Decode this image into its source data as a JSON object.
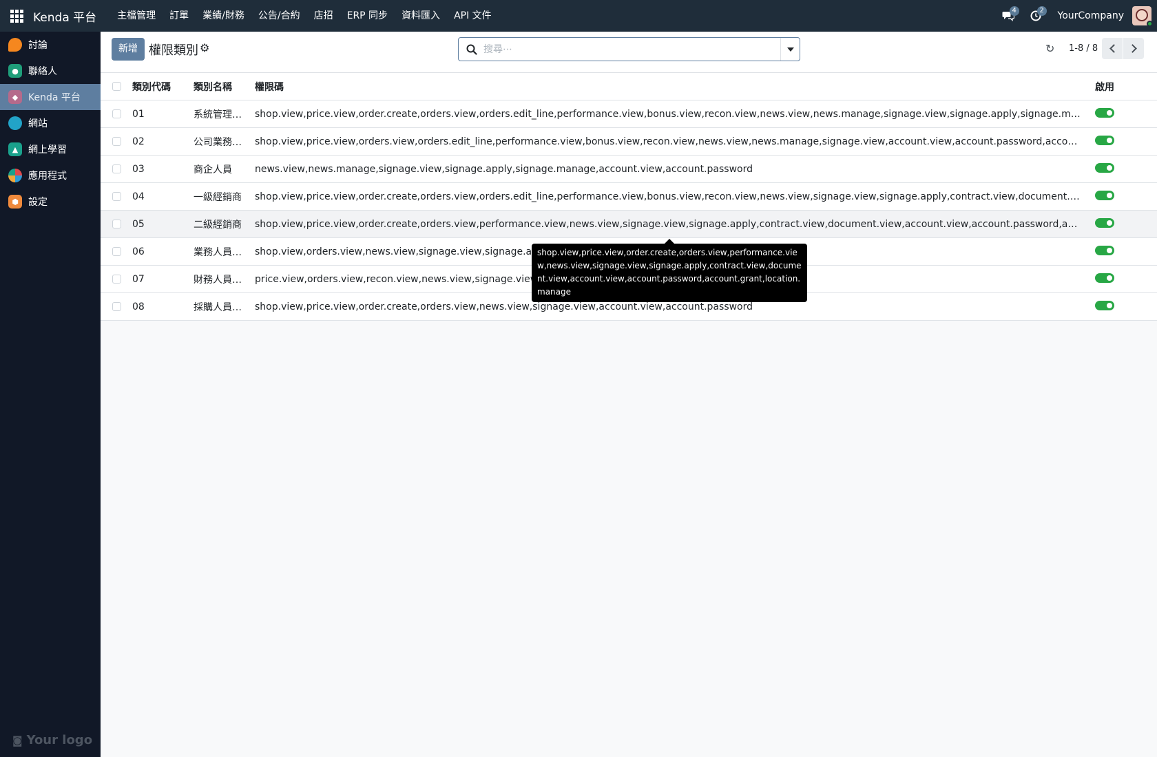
{
  "topbar": {
    "brand": "Kenda 平台",
    "menu": [
      "主檔管理",
      "訂單",
      "業績/財務",
      "公告/合約",
      "店招",
      "ERP 同步",
      "資料匯入",
      "API 文件"
    ],
    "messages_count": "4",
    "activities_count": "2",
    "company": "YourCompany"
  },
  "sidebar": {
    "items": [
      {
        "label": "討論",
        "icon": "discuss-icon",
        "color": "#f5871f"
      },
      {
        "label": "聯絡人",
        "icon": "contacts-icon",
        "color": "#1f9e7a"
      },
      {
        "label": "Kenda 平台",
        "icon": "kenda-icon",
        "color": "#b56a8b"
      },
      {
        "label": "網站",
        "icon": "website-icon",
        "color": "#22a3c8"
      },
      {
        "label": "網上學習",
        "icon": "elearning-icon",
        "color": "#1aa18c"
      },
      {
        "label": "應用程式",
        "icon": "apps-icon",
        "color": "#e0484b"
      },
      {
        "label": "設定",
        "icon": "settings-icon",
        "color": "#f08a3c"
      }
    ],
    "logo_text": "Your logo"
  },
  "control": {
    "new_label": "新增",
    "title": "權限類別",
    "search_placeholder": "搜尋⋯",
    "pager": "1-8 / 8"
  },
  "table": {
    "columns": [
      "類別代碼",
      "類別名稱",
      "權限碼",
      "啟用"
    ],
    "rows": [
      {
        "code": "01",
        "name": "系統管理…",
        "perms": "shop.view,price.view,order.create,orders.view,orders.edit_line,performance.view,bonus.view,recon.view,news.view,news.manage,signage.view,signage.apply,signage.manage,contract.view,d…",
        "active": true
      },
      {
        "code": "02",
        "name": "公司業務…",
        "perms": "shop.view,price.view,orders.view,orders.edit_line,performance.view,bonus.view,recon.view,news.view,news.manage,signage.view,account.view,account.password,account.grant",
        "active": true
      },
      {
        "code": "03",
        "name": "商企人員",
        "perms": "news.view,news.manage,signage.view,signage.apply,signage.manage,account.view,account.password",
        "active": true
      },
      {
        "code": "04",
        "name": "一級經銷商",
        "perms": "shop.view,price.view,order.create,orders.view,orders.edit_line,performance.view,bonus.view,recon.view,news.view,signage.view,signage.apply,contract.view,document.view,account.view,acc…",
        "active": true
      },
      {
        "code": "05",
        "name": "二級經銷商",
        "perms": "shop.view,price.view,order.create,orders.view,performance.view,news.view,signage.view,signage.apply,contract.view,document.view,account.view,account.password,account.grant,location.…",
        "active": true
      },
      {
        "code": "06",
        "name": "業務人員…",
        "perms": "shop.view,orders.view,news.view,signage.view,signage.apply,acc",
        "active": true
      },
      {
        "code": "07",
        "name": "財務人員…",
        "perms": "price.view,orders.view,recon.view,news.view,signage.view,accou",
        "active": true
      },
      {
        "code": "08",
        "name": "採購人員…",
        "perms": "shop.view,price.view,order.create,orders.view,news.view,signage.view,account.view,account.password",
        "active": true
      }
    ]
  },
  "tooltip": {
    "text": "shop.view,price.view,order.create,orders.view,performance.view,news.view,signage.view,signage.apply,contract.view,document.view,account.view,account.password,account.grant,location.manage"
  },
  "colors": {
    "topbar": "#1f2d3a",
    "sidebar": "#111827",
    "accent": "#5e7ea0",
    "toggle_on": "#28a745"
  }
}
